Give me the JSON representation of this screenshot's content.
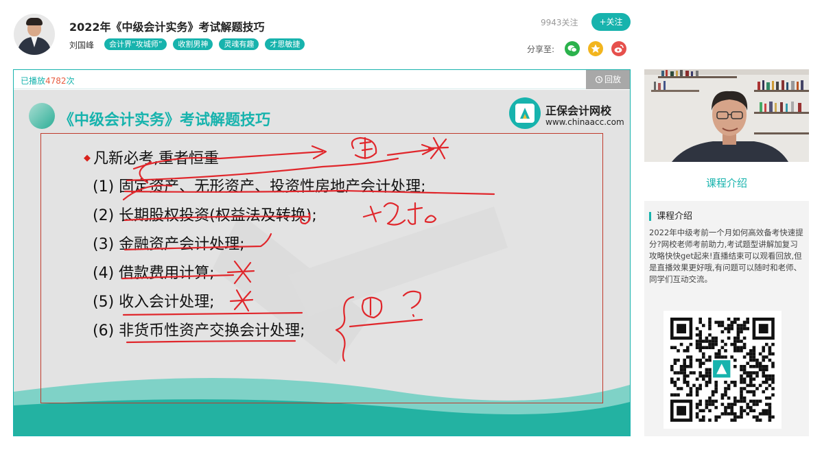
{
  "header": {
    "title": "2022年《中级会计实务》考试解题技巧",
    "teacher": "刘国峰",
    "tags": [
      "会计界“攻城师”",
      "收割男神",
      "灵魂有趣",
      "才思敏捷"
    ],
    "followers": "9943关注",
    "follow_label": "+关注",
    "share_label": "分享至:"
  },
  "player": {
    "play_prefix": "已播放",
    "play_count": "4782",
    "play_suffix": "次",
    "replay_label": "回放"
  },
  "slide": {
    "title": "《中级会计实务》考试解题技巧",
    "logo_name": "正保会计网校",
    "logo_url": "www.chinaacc.com",
    "bullet": "凡新必考,重者恒重",
    "items": [
      "(1) 固定资产、无形资产、投资性房地产会计处理;",
      "(2) 长期股权投资(权益法及转换);",
      "(3) 金融资产会计处理;",
      "(4) 借款费用计算;",
      "(5) 收入会计处理;",
      "(6) 非货币性资产交换会计处理;"
    ]
  },
  "sidebar": {
    "intro_link": "课程介绍",
    "intro_title": "课程介绍",
    "intro_text": "2022年中级考前一个月如何高效备考快速提分?网校老师考前助力,考试题型讲解加复习攻略快快get起来!直播结束可以观看回放,但是直播效果更好哦,有问题可以随时和老师、同学们互动交流。"
  },
  "colors": {
    "accent": "#17b3ad",
    "annotation_red": "#e0262b",
    "frame_red": "#c0392b"
  }
}
